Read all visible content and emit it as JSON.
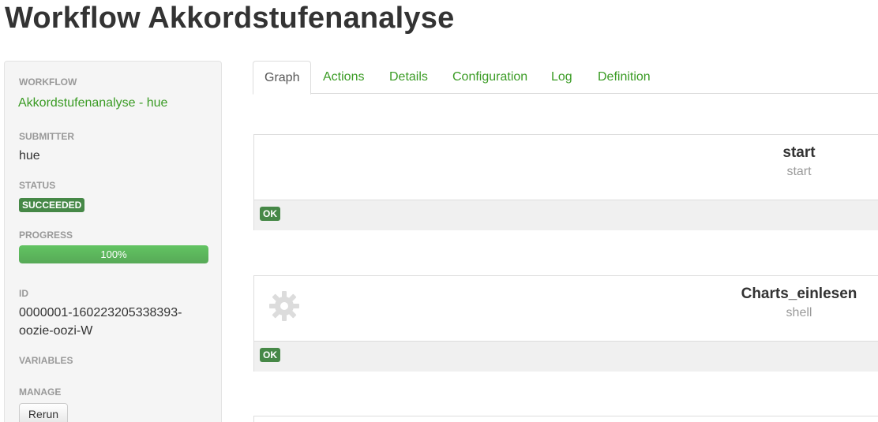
{
  "page": {
    "title": "Workflow Akkordstufenanalyse"
  },
  "sidebar": {
    "workflow_label": "WORKFLOW",
    "workflow_value": "Akkordstufenanalyse - hue",
    "submitter_label": "SUBMITTER",
    "submitter_value": "hue",
    "status_label": "STATUS",
    "status_value": "SUCCEEDED",
    "progress_label": "PROGRESS",
    "progress_text": "100%",
    "progress_percent": 100,
    "id_label": "ID",
    "id_value_line1": "0000001-160223205338393-",
    "id_value_line2": "oozie-oozi-W",
    "variables_label": "VARIABLES",
    "manage_label": "MANAGE",
    "rerun_label": "Rerun"
  },
  "tabs": [
    {
      "label": "Graph",
      "active": true
    },
    {
      "label": "Actions"
    },
    {
      "label": "Details"
    },
    {
      "label": "Configuration"
    },
    {
      "label": "Log"
    },
    {
      "label": "Definition"
    }
  ],
  "nodes": [
    {
      "name": "start",
      "type": "start",
      "status": "OK",
      "icon": ""
    },
    {
      "name": "Charts_einlesen",
      "type": "shell",
      "status": "OK",
      "icon": "gear-icon"
    }
  ],
  "colors": {
    "accent": "#3a9b24",
    "success": "#468847",
    "progress": "#5bb75b"
  }
}
